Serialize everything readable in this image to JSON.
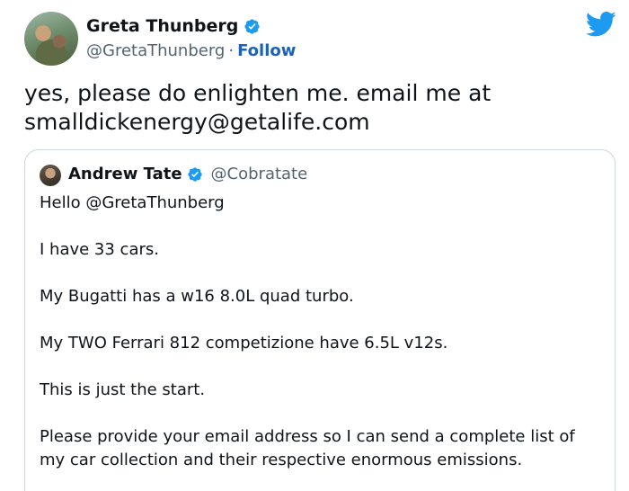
{
  "tweet": {
    "author_name": "Greta Thunberg",
    "author_handle": "@GretaThunberg",
    "separator": "·",
    "follow_label": "Follow",
    "text_line1": "yes, please do enlighten me. email me at",
    "text_line2": "smalldickenergy@getalife.com",
    "avatar_icon": "profile-photo",
    "verified_icon": "verified-badge-icon",
    "logo_icon": "twitter-bird-icon"
  },
  "quoted_tweet": {
    "author_name": "Andrew Tate",
    "author_handle": "@Cobratate",
    "paragraphs": [
      "Hello @GretaThunberg",
      "I have 33 cars.",
      "My Bugatti has a w16 8.0L quad turbo.",
      "My TWO Ferrari 812 competizione have 6.5L v12s.",
      "This is just the start.",
      "Please provide your email address so I can send a complete list of my car collection and their respective enormous emissions."
    ]
  },
  "colors": {
    "twitter_blue": "#1d9bf0",
    "follow_blue": "#1d62b8",
    "secondary_text": "#536471",
    "border": "#cfd9de"
  }
}
